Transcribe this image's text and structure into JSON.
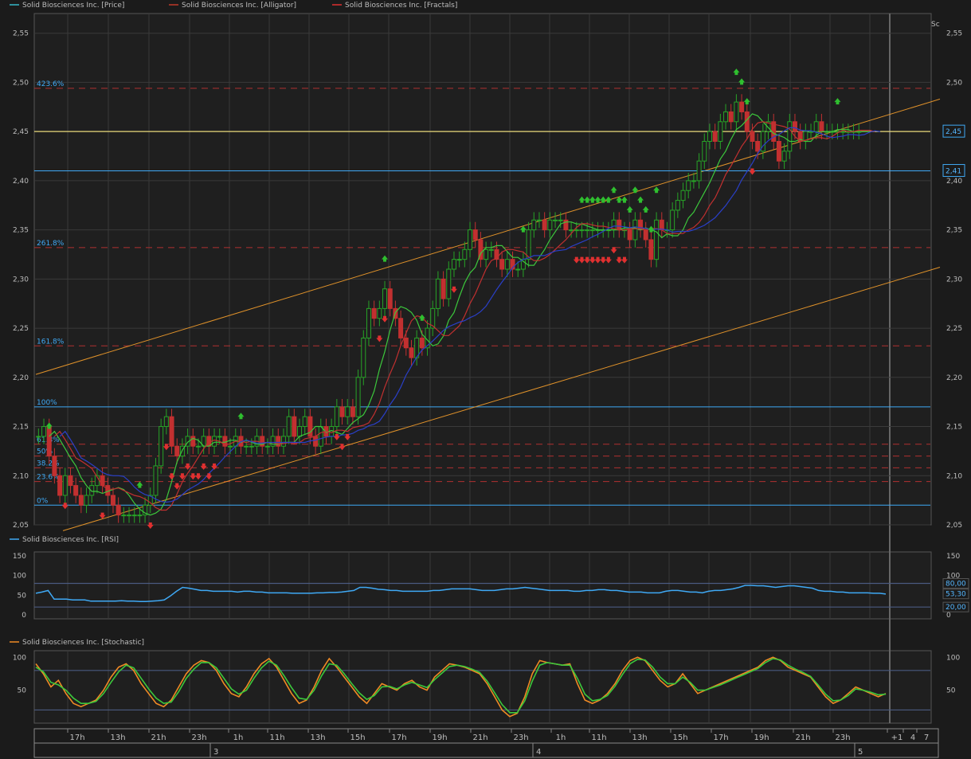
{
  "legend_main": [
    {
      "label": "Solid Biosciences Inc. [Price]",
      "color": "#35b8c9"
    },
    {
      "label": "Solid Biosciences Inc. [Alligator]",
      "color": "#c0392b"
    },
    {
      "label": "Solid Biosciences Inc. [Fractals]",
      "color": "#e03030"
    }
  ],
  "legend_rsi": {
    "label": "Solid Biosciences Inc. [RSI]",
    "color": "#3fa9f5"
  },
  "legend_stoch": {
    "label": "Solid Biosciences Inc. [Stochastic]",
    "color": "#f08a24"
  },
  "sc_label": "Sc",
  "colors": {
    "bg": "#1b1b1b",
    "grid": "#3a3a3a",
    "up": "#27a327",
    "down": "#c23030",
    "fib": "#3fa9f5",
    "fibdash": "#b03030",
    "trend": "#e0922a",
    "hline": "#e8d87a"
  },
  "chart_data": [
    {
      "type": "line",
      "panel": "price",
      "ylim": [
        2.05,
        2.57
      ],
      "y_ticks": [
        "2,55",
        "2,50",
        "2,45",
        "2,40",
        "2,35",
        "2,30",
        "2,25",
        "2,20",
        "2,15",
        "2,10",
        "2,05"
      ],
      "y_tick_values": [
        2.55,
        2.5,
        2.45,
        2.4,
        2.35,
        2.3,
        2.25,
        2.2,
        2.15,
        2.1,
        2.05
      ],
      "fib_levels": [
        {
          "label": "423.6%",
          "value": 2.494,
          "style": "dash"
        },
        {
          "label": "261.8%",
          "value": 2.332,
          "style": "dash"
        },
        {
          "label": "161.8%",
          "value": 2.232,
          "style": "dash"
        },
        {
          "label": "100%",
          "value": 2.17,
          "style": "solid"
        },
        {
          "label": "61.8%",
          "value": 2.132,
          "style": "dash"
        },
        {
          "label": "50%",
          "value": 2.12,
          "style": "dash"
        },
        {
          "label": "38.2%",
          "value": 2.108,
          "style": "dash"
        },
        {
          "label": "23.6%",
          "value": 2.094,
          "style": "dash"
        },
        {
          "label": "0%",
          "value": 2.07,
          "style": "solid"
        }
      ],
      "price_line": {
        "value": 2.45,
        "label": "2,45"
      },
      "level_line": {
        "value": 2.41,
        "label": "2,41"
      },
      "closes": [
        2.14,
        2.15,
        2.12,
        2.1,
        2.08,
        2.1,
        2.09,
        2.08,
        2.07,
        2.08,
        2.09,
        2.1,
        2.09,
        2.08,
        2.07,
        2.06,
        2.06,
        2.06,
        2.06,
        2.06,
        2.07,
        2.08,
        2.11,
        2.15,
        2.16,
        2.13,
        2.12,
        2.13,
        2.14,
        2.13,
        2.13,
        2.14,
        2.13,
        2.14,
        2.14,
        2.13,
        2.13,
        2.14,
        2.13,
        2.13,
        2.13,
        2.14,
        2.13,
        2.13,
        2.14,
        2.13,
        2.14,
        2.16,
        2.14,
        2.15,
        2.16,
        2.14,
        2.13,
        2.15,
        2.14,
        2.15,
        2.17,
        2.16,
        2.17,
        2.16,
        2.2,
        2.24,
        2.27,
        2.26,
        2.27,
        2.29,
        2.27,
        2.26,
        2.24,
        2.23,
        2.22,
        2.24,
        2.23,
        2.25,
        2.27,
        2.3,
        2.28,
        2.31,
        2.32,
        2.32,
        2.33,
        2.35,
        2.34,
        2.32,
        2.33,
        2.33,
        2.32,
        2.31,
        2.32,
        2.31,
        2.31,
        2.32,
        2.35,
        2.36,
        2.36,
        2.35,
        2.36,
        2.36,
        2.36,
        2.35,
        2.35,
        2.35,
        2.35,
        2.35,
        2.35,
        2.35,
        2.35,
        2.35,
        2.36,
        2.35,
        2.35,
        2.34,
        2.36,
        2.35,
        2.34,
        2.32,
        2.36,
        2.35,
        2.35,
        2.37,
        2.38,
        2.39,
        2.4,
        2.4,
        2.42,
        2.44,
        2.45,
        2.44,
        2.46,
        2.47,
        2.46,
        2.48,
        2.47,
        2.45,
        2.44,
        2.43,
        2.45,
        2.46,
        2.44,
        2.42,
        2.43,
        2.46,
        2.45,
        2.44,
        2.45,
        2.45,
        2.46,
        2.45,
        2.45,
        2.45,
        2.45,
        2.45,
        2.45,
        2.45,
        2.45
      ],
      "fractals_up_x": [
        2,
        19,
        38,
        65,
        72,
        91,
        102,
        103,
        104,
        105,
        106,
        107,
        108,
        109,
        110,
        111,
        112,
        113,
        114,
        115,
        116,
        131,
        132,
        133,
        150
      ],
      "fractals_down_x": [
        5,
        12,
        21,
        24,
        25,
        26,
        27,
        28,
        29,
        30,
        31,
        32,
        33,
        56,
        57,
        58,
        64,
        65,
        78,
        101,
        102,
        103,
        104,
        105,
        106,
        107,
        108,
        109,
        110,
        134
      ],
      "trend_lines": [
        {
          "x1": 0,
          "y1": 2.203,
          "x2": 200,
          "y2": 2.483
        },
        {
          "x1": 6,
          "y1": 2.044,
          "x2": 200,
          "y2": 2.312
        }
      ]
    },
    {
      "type": "line",
      "panel": "rsi",
      "ylim": [
        -10,
        160
      ],
      "y_ticks": [
        "150",
        "100",
        "50",
        "0"
      ],
      "y_tick_values": [
        150,
        100,
        50,
        0
      ],
      "levels": [
        {
          "value": 80,
          "label": "80,00"
        },
        {
          "value": 20,
          "label": "20,00"
        }
      ],
      "current": {
        "value": 53.3,
        "label": "53,30"
      },
      "values": [
        55,
        58,
        62,
        40,
        40,
        40,
        38,
        38,
        38,
        35,
        35,
        35,
        35,
        35,
        36,
        35,
        35,
        34,
        34,
        35,
        36,
        38,
        48,
        60,
        70,
        68,
        65,
        62,
        62,
        60,
        60,
        60,
        60,
        58,
        60,
        60,
        58,
        58,
        56,
        56,
        56,
        56,
        55,
        55,
        55,
        55,
        56,
        56,
        57,
        57,
        58,
        60,
        62,
        70,
        70,
        68,
        65,
        64,
        62,
        62,
        60,
        60,
        60,
        60,
        60,
        62,
        62,
        64,
        66,
        66,
        66,
        66,
        64,
        62,
        62,
        62,
        64,
        66,
        66,
        68,
        70,
        68,
        66,
        64,
        62,
        62,
        62,
        62,
        60,
        60,
        62,
        62,
        64,
        64,
        62,
        62,
        60,
        58,
        58,
        58,
        56,
        56,
        56,
        60,
        62,
        62,
        60,
        58,
        58,
        56,
        60,
        62,
        62,
        64,
        66,
        70,
        75,
        75,
        74,
        74,
        72,
        70,
        72,
        74,
        74,
        72,
        70,
        68,
        62,
        60,
        60,
        58,
        58,
        56,
        56,
        56,
        56,
        55,
        55,
        53
      ]
    },
    {
      "type": "line",
      "panel": "stochastic",
      "ylim": [
        0,
        110
      ],
      "y_ticks": [
        "100",
        "50"
      ],
      "y_tick_values": [
        100,
        50
      ],
      "levels": [
        {
          "value": 80
        },
        {
          "value": 20
        }
      ],
      "series": [
        {
          "color": "#f08a24",
          "values": [
            90,
            75,
            55,
            65,
            45,
            30,
            25,
            30,
            35,
            50,
            70,
            85,
            90,
            80,
            60,
            45,
            30,
            25,
            35,
            55,
            75,
            88,
            95,
            92,
            80,
            60,
            45,
            40,
            55,
            75,
            90,
            98,
            85,
            65,
            45,
            30,
            35,
            55,
            80,
            98,
            85,
            70,
            55,
            40,
            30,
            45,
            60,
            55,
            50,
            60,
            65,
            55,
            50,
            70,
            80,
            90,
            88,
            85,
            80,
            75,
            60,
            40,
            20,
            10,
            15,
            40,
            75,
            95,
            92,
            90,
            88,
            90,
            60,
            35,
            30,
            35,
            45,
            60,
            80,
            95,
            100,
            95,
            80,
            65,
            55,
            60,
            75,
            60,
            45,
            50,
            55,
            60,
            65,
            70,
            75,
            80,
            85,
            95,
            100,
            95,
            85,
            80,
            75,
            70,
            55,
            40,
            30,
            35,
            45,
            55,
            50,
            45,
            40,
            45
          ]
        },
        {
          "color": "#3cc83c",
          "values": [
            85,
            78,
            62,
            58,
            50,
            38,
            30,
            30,
            33,
            45,
            62,
            78,
            88,
            84,
            68,
            52,
            38,
            30,
            32,
            48,
            68,
            82,
            92,
            92,
            84,
            68,
            52,
            44,
            50,
            68,
            84,
            94,
            88,
            72,
            54,
            38,
            36,
            50,
            72,
            90,
            88,
            75,
            60,
            46,
            36,
            42,
            55,
            56,
            52,
            58,
            62,
            58,
            54,
            66,
            76,
            86,
            88,
            86,
            82,
            77,
            64,
            46,
            28,
            16,
            16,
            34,
            64,
            88,
            92,
            90,
            88,
            88,
            68,
            44,
            34,
            36,
            42,
            56,
            74,
            90,
            97,
            96,
            85,
            70,
            60,
            60,
            70,
            62,
            50,
            50,
            54,
            58,
            63,
            68,
            73,
            78,
            83,
            92,
            98,
            96,
            88,
            82,
            77,
            71,
            58,
            44,
            34,
            35,
            42,
            52,
            50,
            47,
            43,
            44
          ]
        }
      ]
    }
  ],
  "x_axis": {
    "ticks": [
      "17h",
      "13h",
      "21h",
      "23h",
      "1h",
      "11h",
      "13h",
      "15h",
      "17h",
      "19h",
      "21h",
      "23h",
      "1h",
      "11h",
      "13h",
      "15h",
      "17h",
      "19h",
      "21h",
      "23h",
      "+1",
      "4",
      "7"
    ],
    "days": [
      "3",
      "4",
      "5"
    ]
  }
}
